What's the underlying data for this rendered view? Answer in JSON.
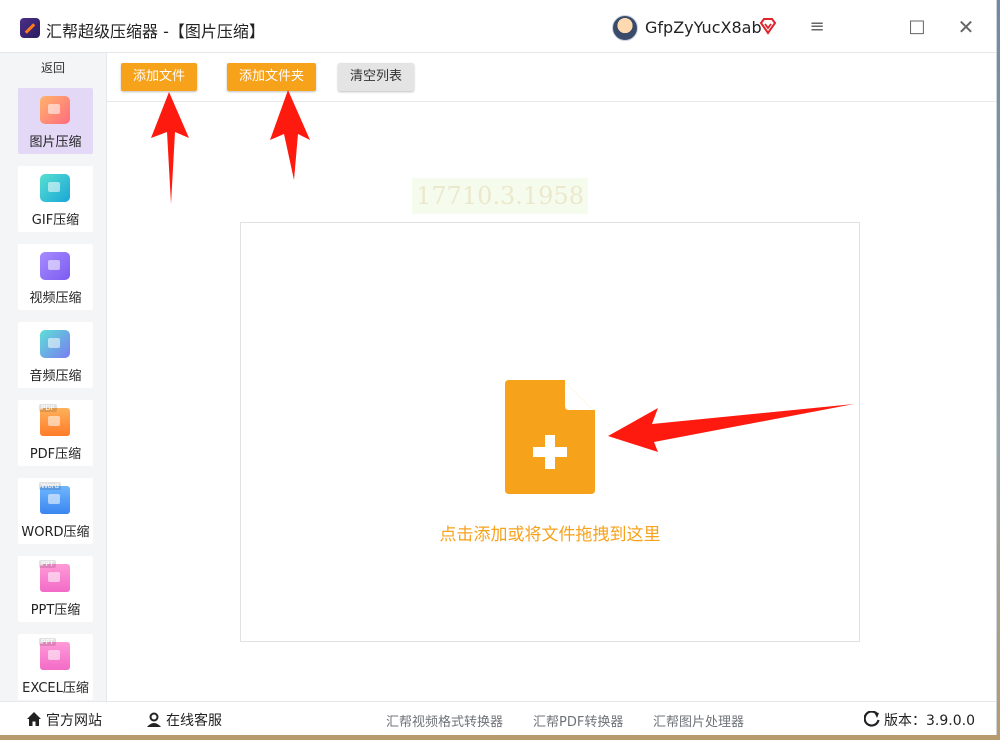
{
  "app": {
    "title": "汇帮超级压缩器  -【图片压缩】",
    "username": "GfpZyYucX8ab",
    "menu_icon": "≡",
    "max_icon": "□",
    "close_icon": "✕"
  },
  "sidebar": {
    "back_label": "返回",
    "items": [
      {
        "label": "图片压缩",
        "icon": "image-icon",
        "active": true
      },
      {
        "label": "GIF压缩",
        "icon": "gif-icon"
      },
      {
        "label": "视频压缩",
        "icon": "video-icon"
      },
      {
        "label": "音频压缩",
        "icon": "audio-icon"
      },
      {
        "label": "PDF压缩",
        "icon": "pdf-icon",
        "tag": "PDF"
      },
      {
        "label": "WORD压缩",
        "icon": "word-icon",
        "tag": "Word"
      },
      {
        "label": "PPT压缩",
        "icon": "ppt-icon",
        "tag": "PPT"
      },
      {
        "label": "EXCEL压缩",
        "icon": "excel-icon",
        "tag": "PPT"
      }
    ]
  },
  "toolbar": {
    "add_file": "添加文件",
    "add_folder": "添加文件夹",
    "clear_list": "清空列表"
  },
  "watermark": "17710.3.1958",
  "dropzone": {
    "text": "点击添加或将文件拖拽到这里"
  },
  "footer": {
    "official_site": "官方网站",
    "online_service": "在线客服",
    "link_video": "汇帮视频格式转换器",
    "link_pdf": "汇帮PDF转换器",
    "link_image": "汇帮图片处理器",
    "version": "版本：3.9.0.0"
  },
  "colors": {
    "accent": "#f7a21b",
    "active_bg": "#e3d8f5",
    "arrow": "#ff1a10"
  }
}
